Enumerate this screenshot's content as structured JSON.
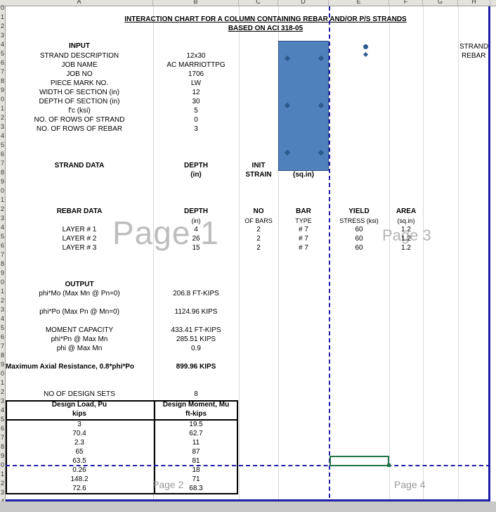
{
  "columns": [
    "A",
    "B",
    "C",
    "D",
    "E",
    "F",
    "G",
    "H"
  ],
  "row_numbers": [
    "0",
    "1",
    "2",
    "3",
    "4",
    "5",
    "6",
    "7",
    "8",
    "9",
    "0",
    "1",
    "2",
    "3",
    "4",
    "5",
    "6",
    "7",
    "8",
    "9",
    "0",
    "1",
    "2",
    "3",
    "4",
    "5",
    "6",
    "7",
    "8",
    "9",
    "0",
    "1",
    "2",
    "3",
    "4",
    "5",
    "6",
    "7",
    "8",
    "9",
    "0",
    "1",
    "2",
    "3",
    "4",
    "5",
    "6",
    "7",
    "8",
    "9",
    "0",
    "1",
    "2",
    "3",
    "4",
    "5",
    "6",
    "7"
  ],
  "title": {
    "line1": "INTERACTION CHART FOR A COLUMN CONTAINING REBAR AND/OR P/S STRANDS",
    "line2": "BASED ON ACI 318-05"
  },
  "input": {
    "heading": "INPUT",
    "rows": [
      {
        "label": "STRAND DESCRIPTION",
        "value": "12x30"
      },
      {
        "label": "JOB NAME",
        "value": "AC MARRIOTTPG"
      },
      {
        "label": "JOB NO",
        "value": "1706"
      },
      {
        "label": "PIECE MARK NO.",
        "value": "LW"
      },
      {
        "label": "WIDTH OF SECTION (in)",
        "value": "12"
      },
      {
        "label": "DEPTH OF SECTION (in)",
        "value": "30"
      },
      {
        "label": "f'c (ksi)",
        "value": "5"
      },
      {
        "label": "NO. OF ROWS OF STRAND",
        "value": "0"
      },
      {
        "label": "NO. OF ROWS OF REBAR",
        "value": "3"
      }
    ]
  },
  "legend": {
    "strand": "STRAND",
    "rebar": "REBAR"
  },
  "strand_data": {
    "heading": "STRAND DATA",
    "col_depth": "DEPTH",
    "col_depth_unit": "(in)",
    "col_init": "INIT",
    "col_strain": "STRAIN",
    "col_area_unit": "(sq.in)"
  },
  "rebar_data": {
    "heading": "REBAR DATA",
    "headers": [
      "DEPTH",
      "NO",
      "BAR",
      "YIELD",
      "AREA"
    ],
    "subheaders": [
      "(in)",
      "OF BARS",
      "TYPE",
      "STRESS (ksi)",
      "(sq.in)"
    ],
    "layers": [
      {
        "name": "LAYER # 1",
        "depth": "4",
        "bars": "2",
        "type": "# 7",
        "yield": "60",
        "area": "1.2"
      },
      {
        "name": "LAYER # 2",
        "depth": "26",
        "bars": "2",
        "type": "# 7",
        "yield": "60",
        "area": "1.2"
      },
      {
        "name": "LAYER # 3",
        "depth": "15",
        "bars": "2",
        "type": "# 7",
        "yield": "60",
        "area": "1.2"
      }
    ]
  },
  "output": {
    "heading": "OUTPUT",
    "rows": [
      {
        "label": "phi*Mo (Max Mn @ Pn=0)",
        "value": "206.8 FT-KIPS"
      },
      {
        "label": "phi*Po (Max Pn @ Mn=0)",
        "value": "1124.96 KIPS"
      },
      {
        "label": "MOMENT CAPACITY",
        "value": "433.41 FT-KIPS"
      },
      {
        "label": "phi*Pn @ Max Mn",
        "value": "285.51 KIPS"
      },
      {
        "label": "phi @ Max Mn",
        "value": "0.9"
      }
    ],
    "max_axial_label": "Maximum Axial Resistance, 0.8*phi*Po",
    "max_axial_value": "899.96 KIPS"
  },
  "design": {
    "sets_label": "NO OF DESIGN SETS",
    "sets_value": "8",
    "header_load": "Design Load, Pu",
    "header_load_unit": "kips",
    "header_moment": "Design Moment, Mu",
    "header_moment_unit": "ft-kips",
    "rows": [
      {
        "pu": "3",
        "mu": "19.5"
      },
      {
        "pu": "70.4",
        "mu": "62.7"
      },
      {
        "pu": "2.3",
        "mu": "11"
      },
      {
        "pu": "65",
        "mu": "87"
      },
      {
        "pu": "63.5",
        "mu": "81"
      },
      {
        "pu": "0.26",
        "mu": "18"
      },
      {
        "pu": "148.2",
        "mu": "71"
      },
      {
        "pu": "72.6",
        "mu": "68.3"
      }
    ]
  },
  "page_labels": {
    "p1": "Page 1",
    "p2": "Page 2",
    "p3": "Page 3",
    "p4": "Page 4"
  },
  "colors": {
    "section_fill": "#4f81bd",
    "page_break": "#1f1fa8",
    "selection": "#217346"
  }
}
